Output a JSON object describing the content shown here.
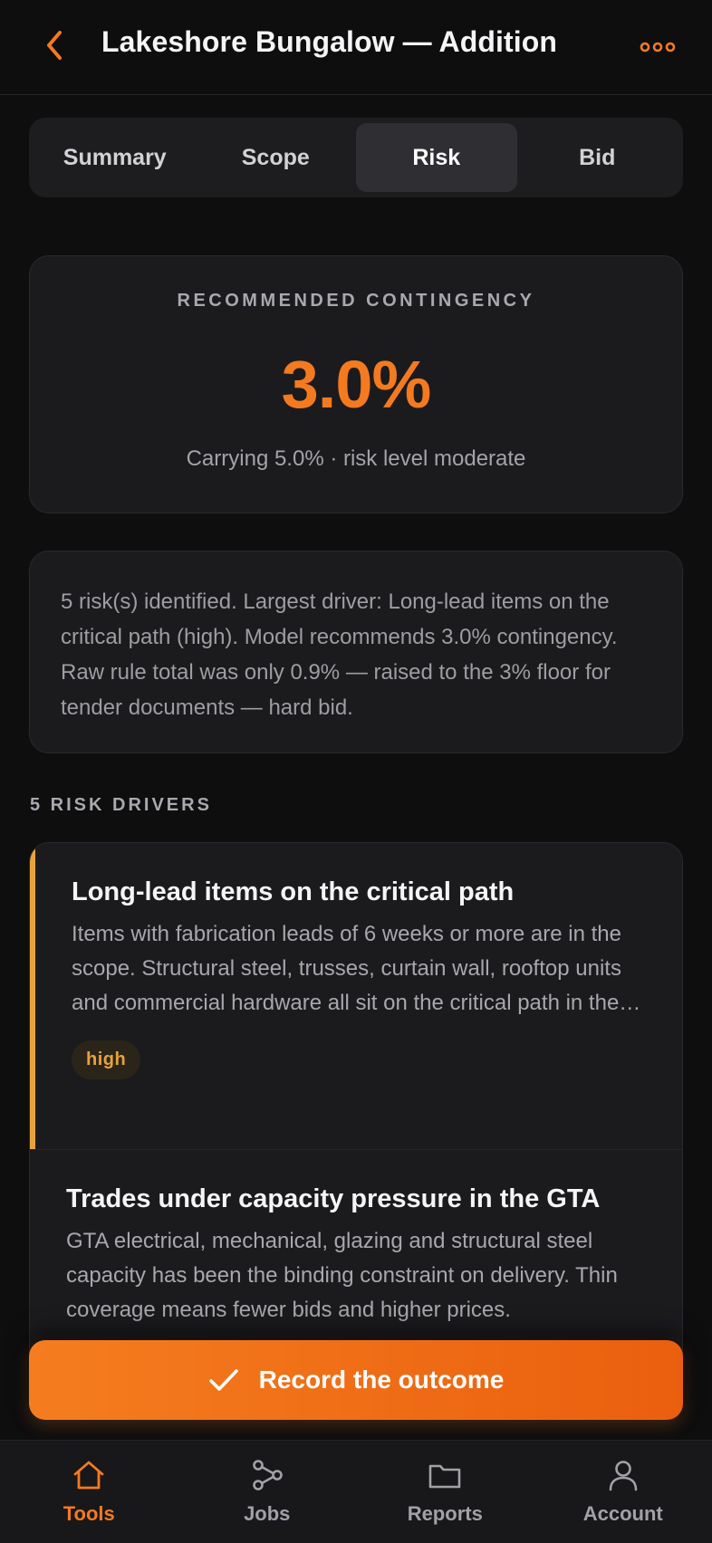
{
  "header": {
    "title": "Lakeshore Bungalow — Addition",
    "back_icon": "chevron-left-icon",
    "more_icon": "ellipsis-icon"
  },
  "tabs": [
    {
      "label": "Summary",
      "active": false
    },
    {
      "label": "Scope",
      "active": false
    },
    {
      "label": "Risk",
      "active": true
    },
    {
      "label": "Bid",
      "active": false
    }
  ],
  "contingency": {
    "label": "RECOMMENDED CONTINGENCY",
    "value": "3.0%",
    "subtext": "Carrying 5.0% · risk level moderate"
  },
  "summary": {
    "text": "5 risk(s) identified. Largest driver: Long-lead items on the critical path (high). Model recommends 3.0% contingency. Raw rule total was only 0.9% — raised to the 3% floor for tender documents — hard bid."
  },
  "risk_section": {
    "label": "5 RISK DRIVERS",
    "items": [
      {
        "title": "Long-lead items on the critical path",
        "description": "Items with fabrication leads of 6 weeks or more are in the scope. Structural steel, trusses, curtain wall, rooftop units and commercial hardware all sit on the critical path in the…",
        "severity": "high"
      },
      {
        "title": "Trades under capacity pressure in the GTA",
        "description": "GTA electrical, mechanical, glazing and structural steel capacity has been the binding constraint on delivery. Thin coverage means fewer bids and higher prices."
      }
    ]
  },
  "cta": {
    "label": "Record the outcome",
    "icon": "checkmark-icon"
  },
  "bottom_nav": [
    {
      "label": "Tools",
      "icon": "home-icon",
      "active": true
    },
    {
      "label": "Jobs",
      "icon": "workflow-icon",
      "active": false
    },
    {
      "label": "Reports",
      "icon": "folder-icon",
      "active": false
    },
    {
      "label": "Account",
      "icon": "person-icon",
      "active": false
    }
  ],
  "colors": {
    "accent": "#f47a1f",
    "background": "#0e0e0f",
    "card": "#1b1b1e",
    "severity_high": "#e8a23c"
  }
}
